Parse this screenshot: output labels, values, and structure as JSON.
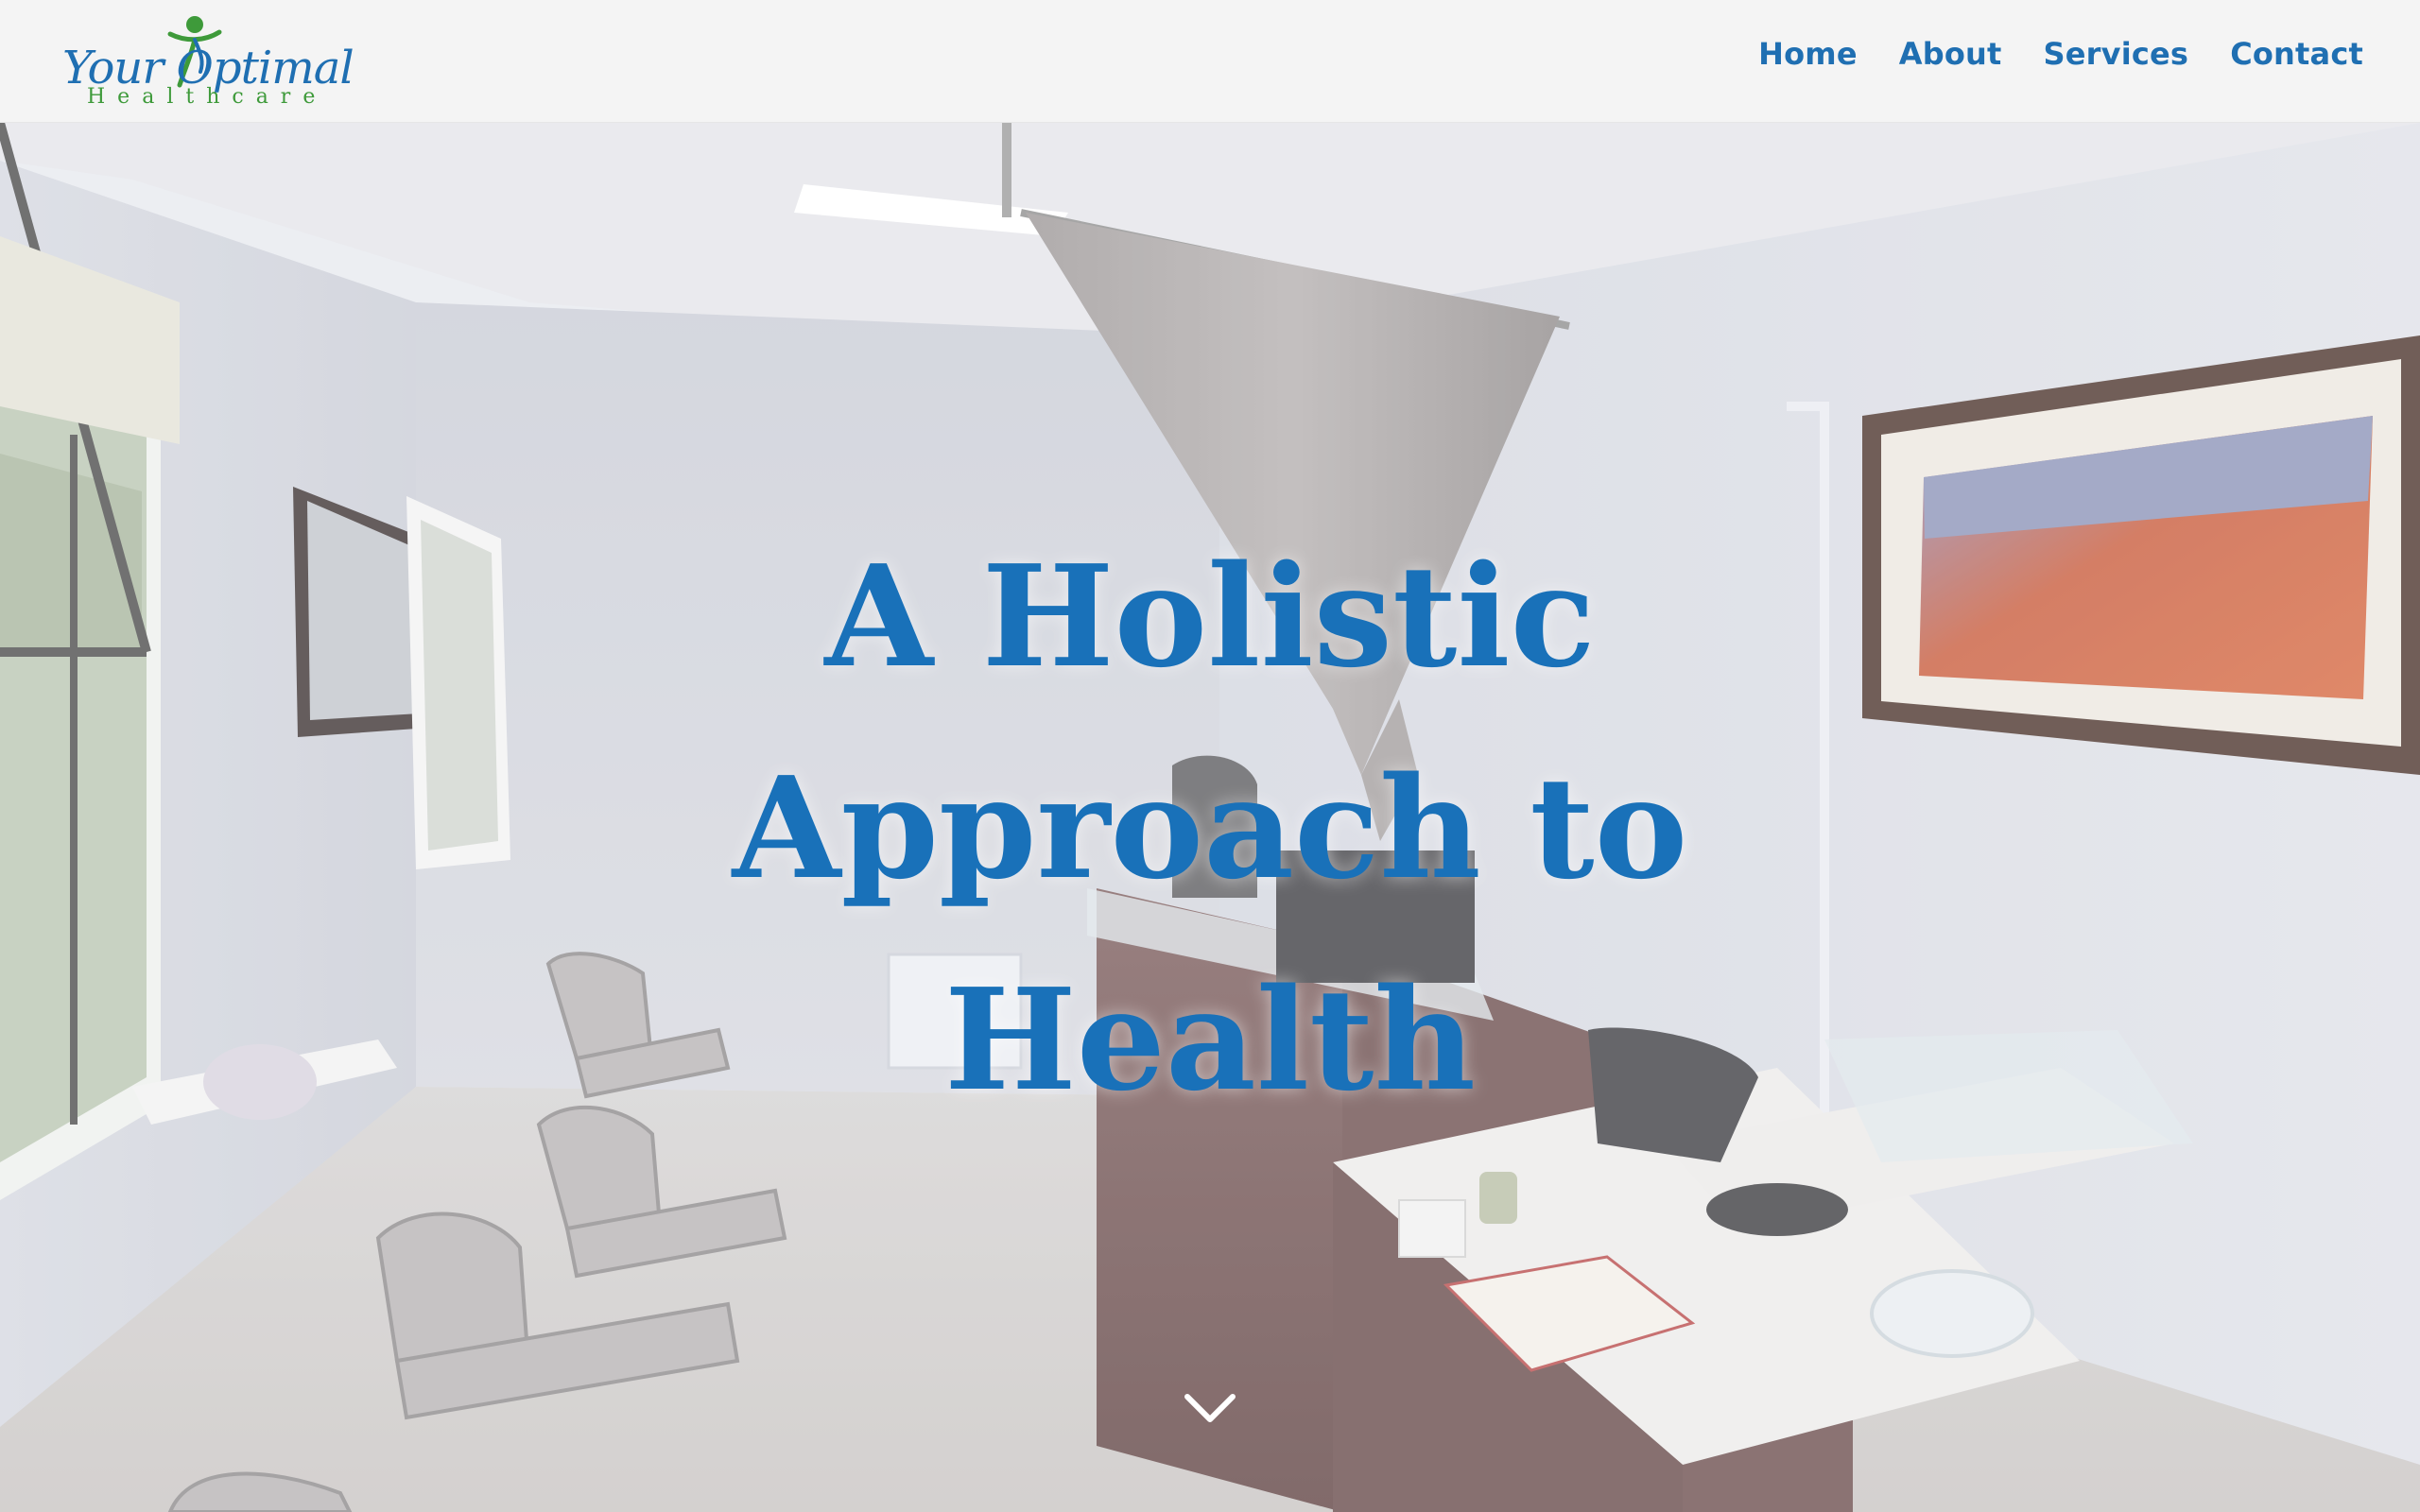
{
  "brand": {
    "name_script": "Your Optimal",
    "name_sub": "Healthcare",
    "colors": {
      "primary_blue": "#1f6fb2",
      "logo_green": "#3e9a3a",
      "header_bg": "#f4f4f4"
    }
  },
  "nav": {
    "items": [
      {
        "label": "Home"
      },
      {
        "label": "About"
      },
      {
        "label": "Services"
      },
      {
        "label": "Contact"
      }
    ]
  },
  "hero": {
    "title": "A Holistic Approach to Health",
    "scroll_icon": "chevron-down-icon"
  }
}
